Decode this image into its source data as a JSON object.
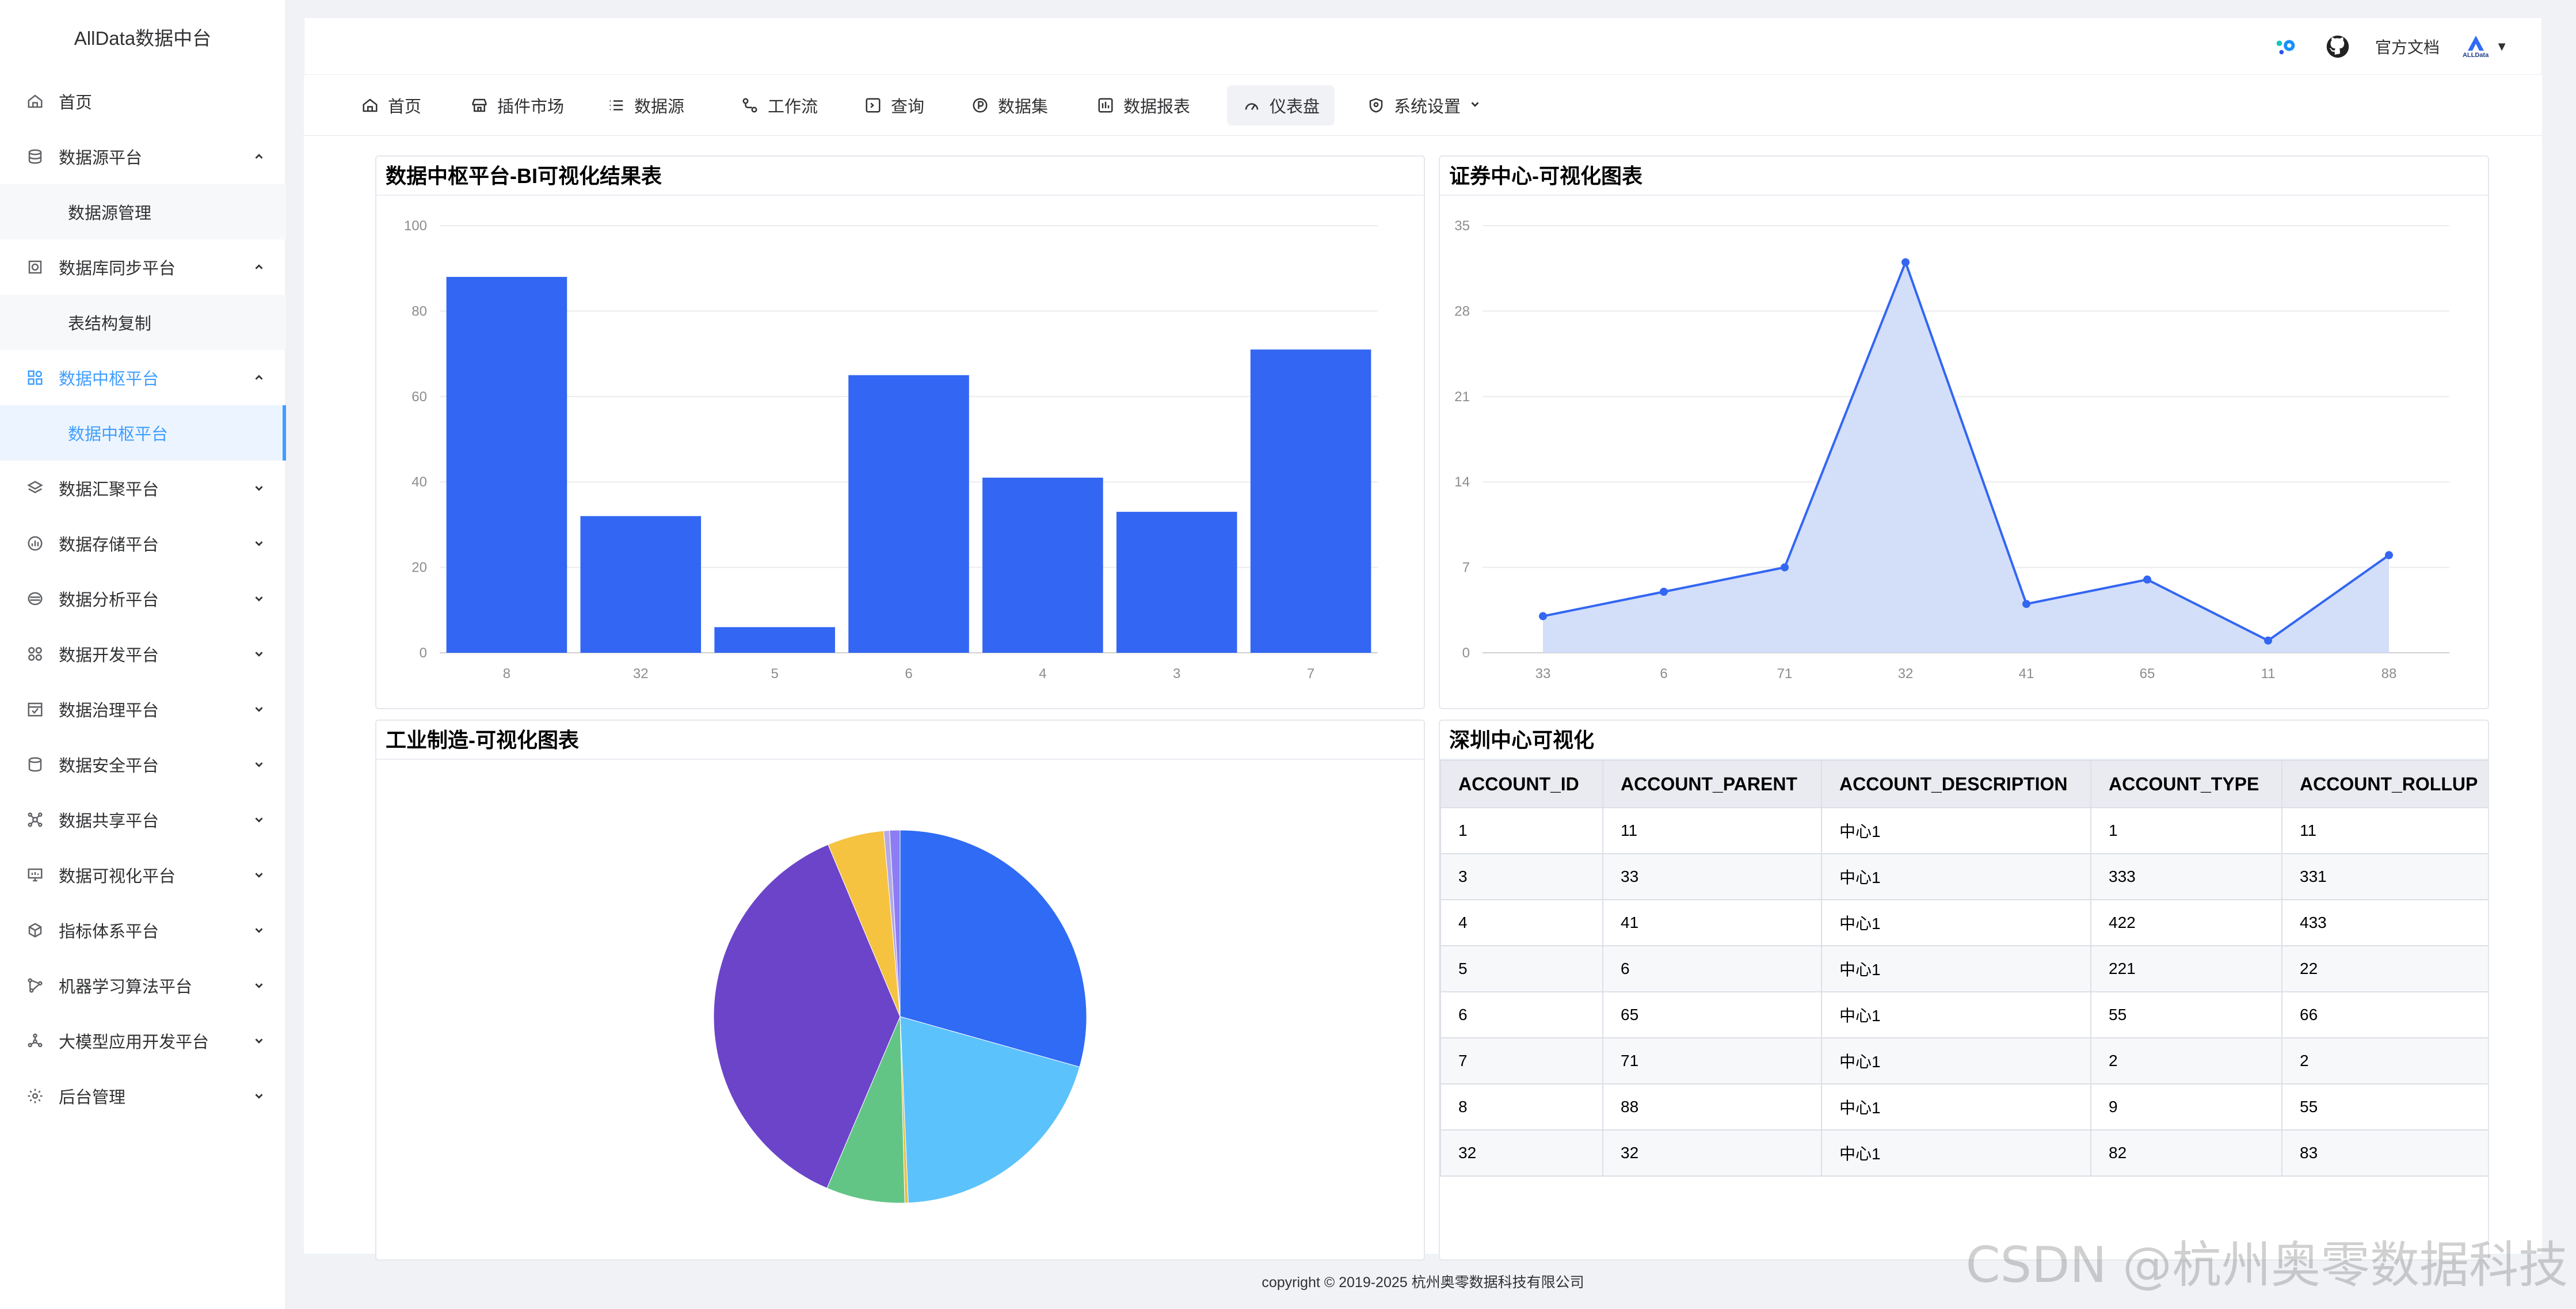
{
  "app": {
    "title": "AllData数据中台"
  },
  "sidebar": {
    "items": [
      {
        "label": "首页",
        "icon": "home-icon"
      },
      {
        "label": "数据源平台",
        "icon": "database-icon",
        "expanded": true,
        "children": [
          "数据源管理"
        ]
      },
      {
        "label": "数据库同步平台",
        "icon": "sync-icon",
        "expanded": true,
        "children": [
          "表结构复制"
        ]
      },
      {
        "label": "数据中枢平台",
        "icon": "hub-icon",
        "expanded": true,
        "active": true,
        "children": [
          "数据中枢平台"
        ]
      },
      {
        "label": "数据汇聚平台",
        "icon": "layers-icon"
      },
      {
        "label": "数据存储平台",
        "icon": "storage-icon"
      },
      {
        "label": "数据分析平台",
        "icon": "analysis-icon"
      },
      {
        "label": "数据开发平台",
        "icon": "develop-icon"
      },
      {
        "label": "数据治理平台",
        "icon": "governance-icon"
      },
      {
        "label": "数据安全平台",
        "icon": "security-icon"
      },
      {
        "label": "数据共享平台",
        "icon": "share-icon"
      },
      {
        "label": "数据可视化平台",
        "icon": "monitor-icon"
      },
      {
        "label": "指标体系平台",
        "icon": "cube-icon"
      },
      {
        "label": "机器学习算法平台",
        "icon": "ml-icon"
      },
      {
        "label": "大模型应用开发平台",
        "icon": "llm-icon"
      },
      {
        "label": "后台管理",
        "icon": "admin-icon"
      }
    ]
  },
  "header": {
    "docs_label": "官方文档",
    "user_logo_text": "ALLData",
    "dropdown_caret": "▼"
  },
  "topnav": {
    "items": [
      {
        "label": "首页",
        "icon": "home-icon"
      },
      {
        "label": "插件市场",
        "icon": "store-icon"
      },
      {
        "label": "数据源",
        "icon": "list-icon"
      },
      {
        "label": "工作流",
        "icon": "workflow-icon"
      },
      {
        "label": "查询",
        "icon": "terminal-icon"
      },
      {
        "label": "数据集",
        "icon": "dataset-icon"
      },
      {
        "label": "数据报表",
        "icon": "report-icon"
      },
      {
        "label": "仪表盘",
        "icon": "dashboard-icon",
        "active": true
      },
      {
        "label": "系统设置",
        "icon": "shield-gear-icon",
        "has_dropdown": true
      }
    ]
  },
  "panels": {
    "bar_title": "数据中枢平台-BI可视化结果表",
    "line_title": "证券中心-可视化图表",
    "pie_title": "工业制造-可视化图表",
    "table_title": "深圳中心可视化"
  },
  "table": {
    "columns": [
      "ACCOUNT_ID",
      "ACCOUNT_PARENT",
      "ACCOUNT_DESCRIPTION",
      "ACCOUNT_TYPE",
      "ACCOUNT_ROLLUP"
    ],
    "rows": [
      [
        "1",
        "11",
        "中心1",
        "1",
        "11"
      ],
      [
        "3",
        "33",
        "中心1",
        "333",
        "331"
      ],
      [
        "4",
        "41",
        "中心1",
        "422",
        "433"
      ],
      [
        "5",
        "6",
        "中心1",
        "221",
        "22"
      ],
      [
        "6",
        "65",
        "中心1",
        "55",
        "66"
      ],
      [
        "7",
        "71",
        "中心1",
        "2",
        "2"
      ],
      [
        "8",
        "88",
        "中心1",
        "9",
        "55"
      ],
      [
        "32",
        "32",
        "中心1",
        "82",
        "83"
      ]
    ]
  },
  "chart_data": [
    {
      "type": "bar",
      "categories": [
        "8",
        "32",
        "5",
        "6",
        "4",
        "3",
        "7"
      ],
      "values": [
        88,
        32,
        6,
        65,
        41,
        33,
        71
      ],
      "ylim": [
        0,
        100
      ],
      "yticks": [
        0,
        20,
        40,
        60,
        80,
        100
      ],
      "grid": true,
      "color": "#3366f2"
    },
    {
      "type": "area",
      "categories": [
        "33",
        "6",
        "71",
        "32",
        "41",
        "65",
        "11",
        "88"
      ],
      "values": [
        3,
        5,
        7,
        32,
        4,
        6,
        1,
        8
      ],
      "ylim": [
        0,
        35
      ],
      "yticks": [
        0,
        7,
        14,
        21,
        28,
        35
      ],
      "grid": true,
      "color": "#3366f2",
      "fill": "#d3def9"
    },
    {
      "type": "pie",
      "values": [
        29.3,
        19.9,
        0.3,
        6.8,
        37.2,
        4.9,
        0.5,
        0.9
      ],
      "colors": [
        "#2f6bf4",
        "#5cc2fb",
        "#e8c14a",
        "#63c585",
        "#6c44c9",
        "#f5c340",
        "#b4a9e6",
        "#8b7ef2"
      ]
    }
  ],
  "footer": {
    "copyright": "copyright © 2019-2025 杭州奥零数据科技有限公司"
  },
  "watermark": "CSDN @杭州奥零数据科技"
}
